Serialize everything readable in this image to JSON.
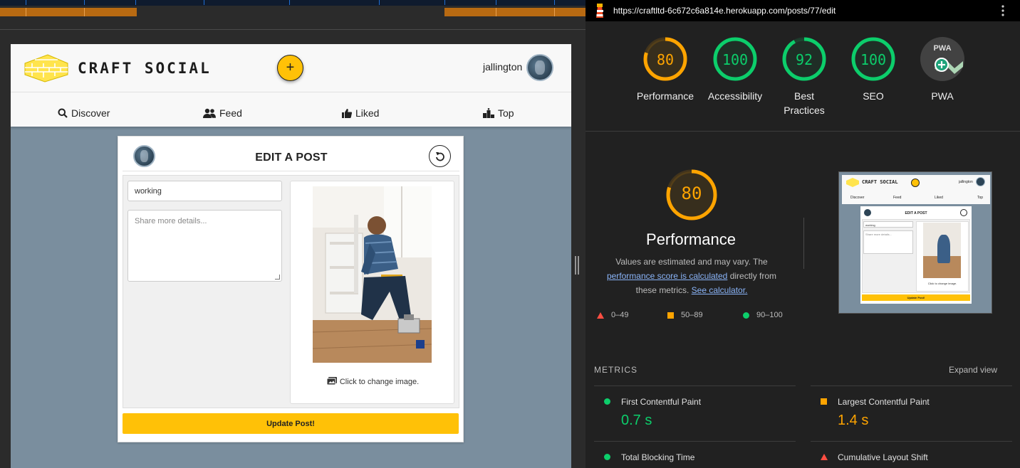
{
  "browser": {
    "url": "https://craftltd-6c672c6a814e.herokuapp.com/posts/77/edit"
  },
  "site": {
    "logo_text": "CRAFT SOCIAL",
    "add_label": "+",
    "username": "jallington",
    "nav": [
      {
        "label": "Discover",
        "icon": "search-icon"
      },
      {
        "label": "Feed",
        "icon": "users-icon"
      },
      {
        "label": "Liked",
        "icon": "thumbs-up-icon"
      },
      {
        "label": "Top",
        "icon": "podium-icon"
      }
    ],
    "edit": {
      "title": "EDIT A POST",
      "title_value": "working",
      "details_placeholder": "Share more details...",
      "change_image": "Click to change image.",
      "update_button": "Update Post!"
    }
  },
  "lighthouse": {
    "scores": [
      {
        "label": "Performance",
        "value": "80",
        "color": "#ffa400"
      },
      {
        "label": "Accessibility",
        "value": "100",
        "color": "#0cce6b"
      },
      {
        "label": "Best Practices",
        "value": "92",
        "color": "#0cce6b"
      },
      {
        "label": "SEO",
        "value": "100",
        "color": "#0cce6b"
      },
      {
        "label": "PWA",
        "value": "PWA",
        "color": "#9e9e9e"
      }
    ],
    "detail": {
      "score": "80",
      "title": "Performance",
      "desc_1": "Values are estimated and may vary. The ",
      "desc_link_1": "performance score is calculated",
      "desc_2": " directly from these metrics. ",
      "desc_link_2": "See calculator."
    },
    "legend": [
      {
        "range": "0–49",
        "color": "#ff4e42"
      },
      {
        "range": "50–89",
        "color": "#ffa400"
      },
      {
        "range": "90–100",
        "color": "#0cce6b"
      }
    ],
    "metrics_heading": "METRICS",
    "expand_view": "Expand view",
    "metrics": [
      {
        "label": "First Contentful Paint",
        "value": "0.7 s",
        "color": "#0cce6b"
      },
      {
        "label": "Largest Contentful Paint",
        "value": "1.4 s",
        "color": "#ffa400"
      },
      {
        "label": "Total Blocking Time",
        "value": "",
        "color": "#0cce6b"
      },
      {
        "label": "Cumulative Layout Shift",
        "value": "",
        "color": "#ff4e42"
      }
    ],
    "thumbnail": {
      "logo_text": "CRAFT SOCIAL",
      "username": "jallington",
      "nav": [
        "Discover",
        "Feed",
        "Liked",
        "Top"
      ],
      "title": "EDIT A POST",
      "title_value": "working",
      "details_placeholder": "Share more details...",
      "change_image": "Click to change image.",
      "update_button": "Update Post!"
    }
  }
}
